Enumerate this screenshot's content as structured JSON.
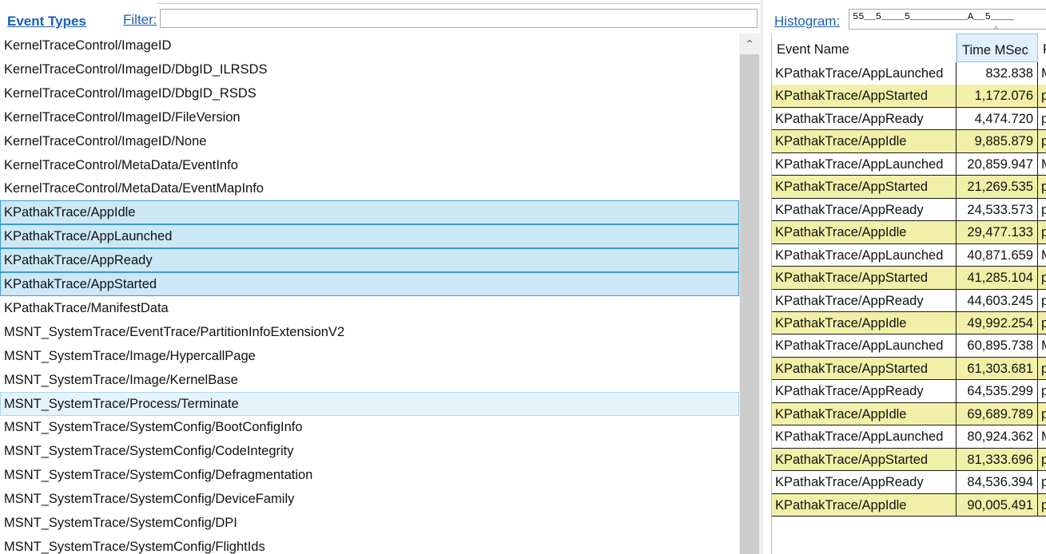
{
  "header": {
    "event_types_label": "Event Types",
    "filter_label": "Filter:",
    "filter_value": ""
  },
  "event_types": [
    {
      "label": "KernelTraceControl/ImageID",
      "state": "normal"
    },
    {
      "label": "KernelTraceControl/ImageID/DbgID_ILRSDS",
      "state": "normal"
    },
    {
      "label": "KernelTraceControl/ImageID/DbgID_RSDS",
      "state": "normal"
    },
    {
      "label": "KernelTraceControl/ImageID/FileVersion",
      "state": "normal"
    },
    {
      "label": "KernelTraceControl/ImageID/None",
      "state": "normal"
    },
    {
      "label": "KernelTraceControl/MetaData/EventInfo",
      "state": "normal"
    },
    {
      "label": "KernelTraceControl/MetaData/EventMapInfo",
      "state": "normal"
    },
    {
      "label": "KPathakTrace/AppIdle",
      "state": "selected"
    },
    {
      "label": "KPathakTrace/AppLaunched",
      "state": "selected"
    },
    {
      "label": "KPathakTrace/AppReady",
      "state": "selected"
    },
    {
      "label": "KPathakTrace/AppStarted",
      "state": "selected"
    },
    {
      "label": "KPathakTrace/ManifestData",
      "state": "normal"
    },
    {
      "label": "MSNT_SystemTrace/EventTrace/PartitionInfoExtensionV2",
      "state": "normal"
    },
    {
      "label": "MSNT_SystemTrace/Image/HypercallPage",
      "state": "normal"
    },
    {
      "label": "MSNT_SystemTrace/Image/KernelBase",
      "state": "normal"
    },
    {
      "label": "MSNT_SystemTrace/Process/Terminate",
      "state": "hover"
    },
    {
      "label": "MSNT_SystemTrace/SystemConfig/BootConfigInfo",
      "state": "normal"
    },
    {
      "label": "MSNT_SystemTrace/SystemConfig/CodeIntegrity",
      "state": "normal"
    },
    {
      "label": "MSNT_SystemTrace/SystemConfig/Defragmentation",
      "state": "normal"
    },
    {
      "label": "MSNT_SystemTrace/SystemConfig/DeviceFamily",
      "state": "normal"
    },
    {
      "label": "MSNT_SystemTrace/SystemConfig/DPI",
      "state": "normal"
    },
    {
      "label": "MSNT_SystemTrace/SystemConfig/FlightIds",
      "state": "normal"
    }
  ],
  "histogram": {
    "label": "Histogram:",
    "value": "55__5____5__________A__5____"
  },
  "grid": {
    "columns": [
      "Event Name",
      "Time MSec",
      "P"
    ],
    "sort_indicator": "^",
    "rows": [
      {
        "name": "KPathakTrace/AppLaunched",
        "time": "832.838",
        "extra": "M"
      },
      {
        "name": "KPathakTrace/AppStarted",
        "time": "1,172.076",
        "extra": "p"
      },
      {
        "name": "KPathakTrace/AppReady",
        "time": "4,474.720",
        "extra": "p"
      },
      {
        "name": "KPathakTrace/AppIdle",
        "time": "9,885.879",
        "extra": "p"
      },
      {
        "name": "KPathakTrace/AppLaunched",
        "time": "20,859.947",
        "extra": "M"
      },
      {
        "name": "KPathakTrace/AppStarted",
        "time": "21,269.535",
        "extra": "p"
      },
      {
        "name": "KPathakTrace/AppReady",
        "time": "24,533.573",
        "extra": "p"
      },
      {
        "name": "KPathakTrace/AppIdle",
        "time": "29,477.133",
        "extra": "p"
      },
      {
        "name": "KPathakTrace/AppLaunched",
        "time": "40,871.659",
        "extra": "M"
      },
      {
        "name": "KPathakTrace/AppStarted",
        "time": "41,285.104",
        "extra": "p"
      },
      {
        "name": "KPathakTrace/AppReady",
        "time": "44,603.245",
        "extra": "p"
      },
      {
        "name": "KPathakTrace/AppIdle",
        "time": "49,992.254",
        "extra": "p"
      },
      {
        "name": "KPathakTrace/AppLaunched",
        "time": "60,895.738",
        "extra": "M"
      },
      {
        "name": "KPathakTrace/AppStarted",
        "time": "61,303.681",
        "extra": "p"
      },
      {
        "name": "KPathakTrace/AppReady",
        "time": "64,535.299",
        "extra": "p"
      },
      {
        "name": "KPathakTrace/AppIdle",
        "time": "69,689.789",
        "extra": "p"
      },
      {
        "name": "KPathakTrace/AppLaunched",
        "time": "80,924.362",
        "extra": "M"
      },
      {
        "name": "KPathakTrace/AppStarted",
        "time": "81,333.696",
        "extra": "p"
      },
      {
        "name": "KPathakTrace/AppReady",
        "time": "84,536.394",
        "extra": "p"
      },
      {
        "name": "KPathakTrace/AppIdle",
        "time": "90,005.491",
        "extra": "p"
      }
    ]
  },
  "colors": {
    "link": "#1a5fb4",
    "selection_bg": "#cce8f7",
    "selection_border": "#3d9ad1",
    "row_alt": "#f2f0a8"
  },
  "icons": {
    "scroll_up": "chevron-up-icon"
  }
}
